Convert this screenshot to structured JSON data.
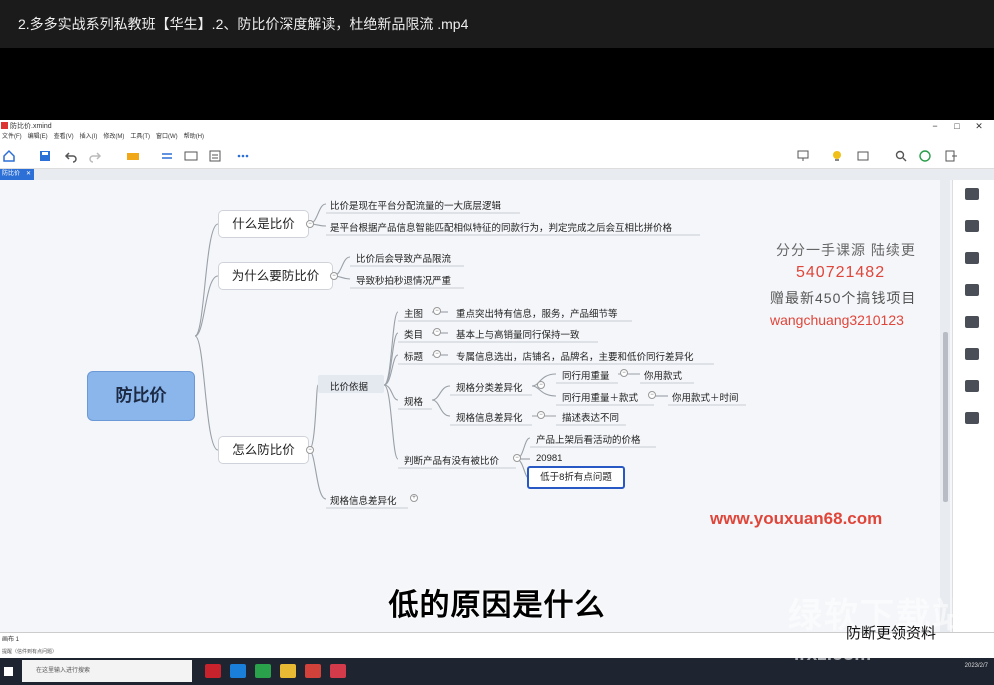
{
  "video": {
    "title": "2.多多实战系列私教班【华生】.2、防比价深度解读，杜绝新品限流 .mp4"
  },
  "app": {
    "window_title": "防比价.xmind",
    "menu": [
      "文件(F)",
      "编辑(E)",
      "查看(V)",
      "插入(I)",
      "修改(M)",
      "工具(T)",
      "窗口(W)",
      "帮助(H)"
    ],
    "tab_label": "防比价",
    "status_left": "画布 1",
    "status_bottom": "提醒（信件到有点问题）"
  },
  "mindmap": {
    "root": "防比价",
    "what": {
      "label": "什么是比价",
      "items": [
        "比价是现在平台分配流量的一大底层逻辑",
        "是平台根据产品信息智能匹配相似特征的同款行为，判定完成之后会互相比拼价格"
      ]
    },
    "why": {
      "label": "为什么要防比价",
      "items": [
        "比价后会导致产品限流",
        "导致秒拍秒退情况严重"
      ]
    },
    "how": {
      "label": "怎么防比价",
      "basis": "比价依据",
      "basis_items": [
        {
          "label": "主图",
          "detail": "重点突出特有信息，服务，产品细节等"
        },
        {
          "label": "类目",
          "detail": "基本上与高销量同行保持一致"
        },
        {
          "label": "标题",
          "detail": "专属信息选出，店铺名，品牌名，主要和低价同行差异化"
        }
      ],
      "spec": {
        "label": "规格",
        "category_diff": "规格分类差异化",
        "same_weight": "同行用重量",
        "use_style": "你用款式",
        "same_weight_style": "同行用重量＋款式",
        "use_style_time": "你用款式＋时间",
        "info_diff": "规格信息差异化",
        "desc_diff": "描述表达不同"
      },
      "judge": {
        "label": "判断产品有没有被比价",
        "item1": "产品上架后看活动的价格",
        "item2": "20981",
        "item3": "低于8折有点问题"
      },
      "spec_info_diff": "规格信息差异化"
    }
  },
  "overlays": {
    "promo_line1": "分分一手课源 陆续更",
    "promo_qq": "540721482",
    "promo_line3": "赠最新450个搞钱项目",
    "promo_wechat": "wangchuang3210123",
    "site": "www.youxuan68.com",
    "subtitle": "低的原因是什么",
    "corner_brand": "绿软下载站",
    "corner_url": "lrxz.com",
    "corner_note": "防断更领资料"
  },
  "taskbar": {
    "search_placeholder": "在这里输入进行搜索",
    "date": "2023/2/7"
  },
  "colors": {
    "root_fill": "#8ab6ec",
    "promo_red": "#e0453a",
    "highlight_border": "#2858c4"
  }
}
